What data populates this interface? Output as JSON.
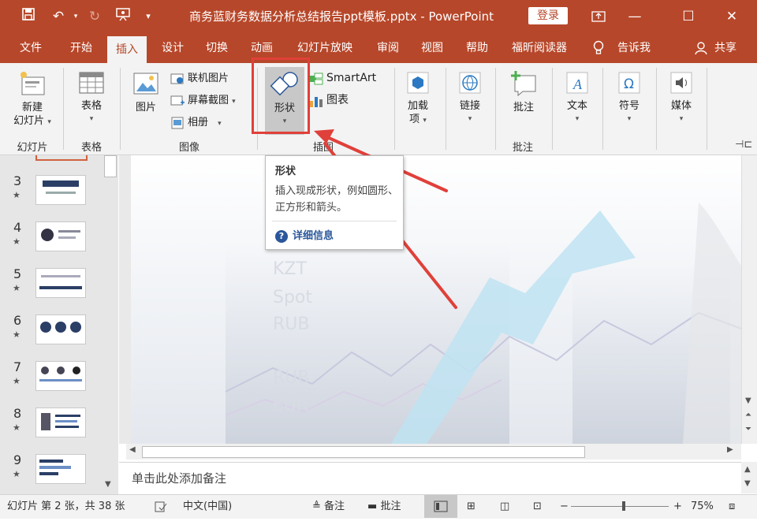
{
  "window": {
    "title": "商务蓝财务数据分析总结报告ppt模板.pptx  -  PowerPoint",
    "login_label": "登录",
    "controls": [
      "restore-ribbon",
      "minimize",
      "maximize",
      "close"
    ]
  },
  "quick_access": {
    "icons": [
      "save-icon",
      "undo-icon",
      "redo-icon",
      "present-icon",
      "customize-icon"
    ]
  },
  "tabs": [
    {
      "label": "文件"
    },
    {
      "label": "开始"
    },
    {
      "label": "插入",
      "active": true
    },
    {
      "label": "设计"
    },
    {
      "label": "切换"
    },
    {
      "label": "动画"
    },
    {
      "label": "幻灯片放映"
    },
    {
      "label": "审阅"
    },
    {
      "label": "视图"
    },
    {
      "label": "帮助"
    },
    {
      "label": "福昕阅读器"
    },
    {
      "label": "告诉我"
    },
    {
      "label": "共享"
    }
  ],
  "ribbon": {
    "new_slide": "新建",
    "new_slide_2": "幻灯片",
    "group_slides": "幻灯片",
    "table": "表格",
    "group_table": "表格",
    "picture": "图片",
    "online_pictures": "联机图片",
    "screenshot": "屏幕截图",
    "album": "相册",
    "group_images": "图像",
    "shapes": "形状",
    "smartart": "SmartArt",
    "chart": "图表",
    "group_illustrations": "插图",
    "addins": "加载",
    "addins_2": "项",
    "link": "链接",
    "comment": "批注",
    "group_comments": "批注",
    "text": "文本",
    "symbols": "符号",
    "media": "媒体"
  },
  "tooltip": {
    "title": "形状",
    "description": "插入现成形状，例如圆形、正方形和箭头。",
    "more_info": "详细信息"
  },
  "slides": [
    {
      "number": "3",
      "star": "★"
    },
    {
      "number": "4",
      "star": "★"
    },
    {
      "number": "5",
      "star": "★"
    },
    {
      "number": "6",
      "star": "★"
    },
    {
      "number": "7",
      "star": "★"
    },
    {
      "number": "8",
      "star": "★"
    },
    {
      "number": "9",
      "star": "★"
    }
  ],
  "slide_bg_text": [
    "KZT",
    "Spot",
    "RUB",
    "RUB",
    "EUR"
  ],
  "notes_placeholder": "单击此处添加备注",
  "status": {
    "slide_info": "幻灯片 第 2 张，共 38 张",
    "language": "中文(中国)",
    "notes_label": "备注",
    "comments_label": "批注",
    "zoom": "75%"
  },
  "accent_color": "#b7472a",
  "highlight_color": "#e0403a"
}
